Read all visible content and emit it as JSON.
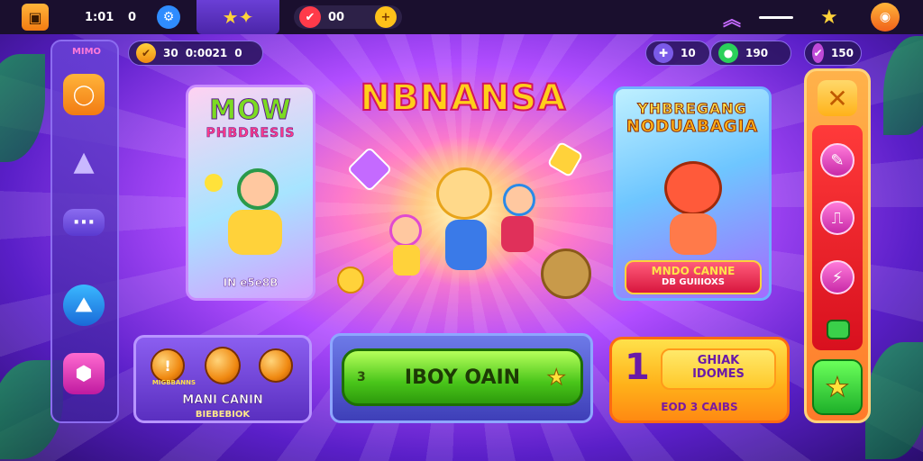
{
  "topbar": {
    "time": "1:01",
    "counter_icon_text": "0",
    "currency_value": "00"
  },
  "left_sidebar": {
    "title": "MIMO"
  },
  "currency_row": {
    "coins_value": "30",
    "gems_value": "0:0021",
    "gems_suffix": "0",
    "right_a_value": "10",
    "right_b_value": "190",
    "right_c_value": "150"
  },
  "title": "NBNANSA",
  "left_card": {
    "title_line1": "MOW",
    "title_line2": "PHBDRESIS",
    "footer": "IN e5e8B"
  },
  "right_card": {
    "title_line1": "YHBREGANG",
    "title_line2": "NODUABAGIA",
    "banner_line1": "MNDO CANNE",
    "banner_line2": "DB GUIIIOXS"
  },
  "bottom_left": {
    "coin_label": "MIGBBANNS",
    "title": "MANI CANIN",
    "subtitle": "BIEBEBIOK"
  },
  "bottom_center": {
    "number": "3",
    "play_label": "IBOY OAIN"
  },
  "bottom_right": {
    "number": "1",
    "line1": "GHIAK",
    "line2": "IDOMES",
    "footer": "EOD 3 CAIBS"
  },
  "colors": {
    "accent": "#b14dff",
    "play_green": "#49c51a",
    "gold": "#ffcf1a"
  }
}
